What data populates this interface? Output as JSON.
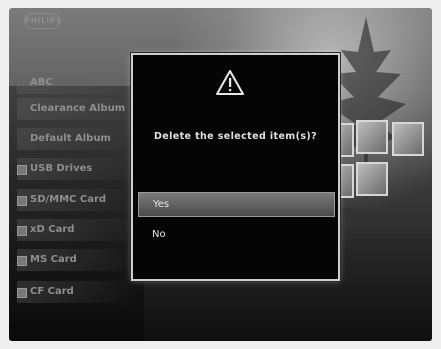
{
  "background": {
    "logo_text": "PHILIPS",
    "left_menu": [
      {
        "label": "ABC"
      },
      {
        "label": "Clearance Album"
      },
      {
        "label": "Default Album"
      },
      {
        "label": "USB Drives"
      },
      {
        "label": "SD/MMC Card"
      },
      {
        "label": "xD Card"
      },
      {
        "label": "MS Card"
      },
      {
        "label": "CF Card"
      }
    ]
  },
  "dialog": {
    "icon": "warning-triangle-icon",
    "message": "Delete the selected item(s)?",
    "options": [
      {
        "label": "Yes",
        "selected": true
      },
      {
        "label": "No",
        "selected": false
      }
    ]
  },
  "colors": {
    "dialog_bg": "#050505",
    "dialog_border": "#cfcfcf",
    "selection": "#6a6a6a"
  }
}
